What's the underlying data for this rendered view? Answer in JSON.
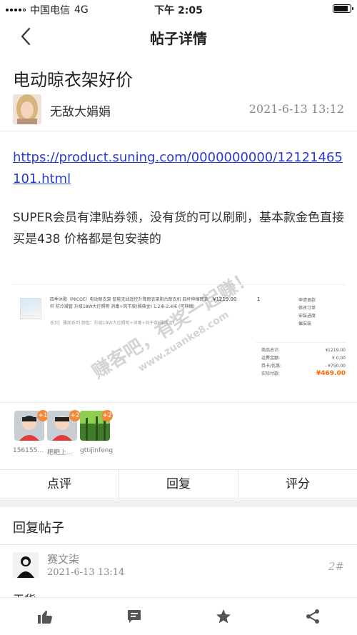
{
  "status_bar": {
    "carrier": "中国电信",
    "network": "4G",
    "time": "下午 2:05"
  },
  "nav": {
    "title": "帖子详情"
  },
  "post": {
    "title": "电动晾衣架好价",
    "author": "无敌大娟娟",
    "date": "2021-6-13 13:12",
    "link": "https://product.suning.com/0000000000/12121465101.html",
    "body": "SUPER会员有津贴券领，没有货的可以刷刷，基本款金色直接买是438   价格都是包安装的"
  },
  "order_image": {
    "product_desc": "四季沐歌（MICOE）电动晾衣架 智能无线遥控升降晾衣架阳台晾衣机 四杆伸缩晾衣杆 防冷凝管 升级18W大灯照明 消毒+风干款(雅典金) 1.2米-2.4米 (可伸缩)",
    "product_sub": "系列：雅阁系列  颜色：升级18W大灯照明+消毒+风干款(雅典金)",
    "price": "¥1219.00",
    "qty": "1",
    "actions": [
      "申请退款",
      "修改订单",
      "安装进度",
      "催安装"
    ],
    "summary": [
      {
        "label": "商品总计:",
        "value": "¥1219.00"
      },
      {
        "label": "运费金额:",
        "value": "¥ 0.00"
      },
      {
        "label": "券卡/优惠:",
        "value": "- ¥750.00"
      }
    ],
    "total_label": "实际付款:",
    "total_value": "¥469.00"
  },
  "watermark": {
    "line1": "赚客吧，有奖一起赚！",
    "line2": "www.zuanke8.com"
  },
  "raters": [
    {
      "name": "1561551...",
      "badge": "+1",
      "avatar": "cartoon-boy"
    },
    {
      "name": "粑粑上...",
      "badge": "+2",
      "avatar": "cartoon-boy"
    },
    {
      "name": "gttijinfeng",
      "badge": "+2",
      "avatar": "green-forest"
    }
  ],
  "actions": {
    "comment": "点评",
    "reply": "回复",
    "rate": "评分"
  },
  "replies": {
    "header": "回复帖子",
    "items": [
      {
        "author": "赛文柒",
        "date": "2021-6-13 13:14",
        "floor": "2#",
        "content": "无货"
      }
    ]
  },
  "bottom_tabs": [
    {
      "icon": "thumbs-up-icon"
    },
    {
      "icon": "comment-icon"
    },
    {
      "icon": "star-icon"
    },
    {
      "icon": "share-icon"
    }
  ]
}
